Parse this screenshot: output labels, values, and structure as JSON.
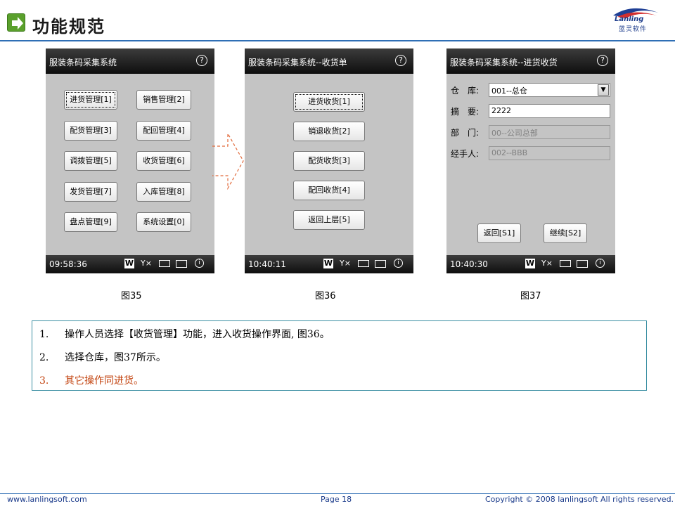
{
  "header": {
    "title": "功能规范",
    "logo_text": "Lanling",
    "logo_sub": "蓝灵软件"
  },
  "screens": [
    {
      "title": "服装条码采集系统",
      "buttons": [
        "进货管理[1]",
        "销售管理[2]",
        "配货管理[3]",
        "配回管理[4]",
        "调拨管理[5]",
        "收货管理[6]",
        "发货管理[7]",
        "入库管理[8]",
        "盘点管理[9]",
        "系统设置[0]"
      ],
      "time": "09:58:36",
      "caption": "图35"
    },
    {
      "title": "服装条码采集系统--收货单",
      "buttons": [
        "进货收货[1]",
        "销退收货[2]",
        "配货收货[3]",
        "配回收货[4]",
        "返回上层[5]"
      ],
      "time": "10:40:11",
      "caption": "图36"
    },
    {
      "title": "服装条码采集系统--进货收货",
      "fields": [
        {
          "label": "仓　库:",
          "value": "001--总仓"
        },
        {
          "label": "摘　要:",
          "value": "2222"
        },
        {
          "label": "部　门:",
          "value": "00--公司总部"
        },
        {
          "label": "经手人:",
          "value": "002--BBB"
        }
      ],
      "buttons": [
        "返回[S1]",
        "继续[S2]"
      ],
      "time": "10:40:30",
      "caption": "图37"
    }
  ],
  "status_icons": {
    "w": "W",
    "signal": "Y×",
    "battery": "",
    "keyboard": "",
    "info": "i",
    "help": "?"
  },
  "notes": [
    {
      "num": "1.",
      "text": "操作人员选择【收货管理】功能，进入收货操作界面, 图36。"
    },
    {
      "num": "2.",
      "text": "选择仓库，图37所示。"
    },
    {
      "num": "3.",
      "text": "其它操作同进货。"
    }
  ],
  "footer": {
    "website": "www.lanlingsoft.com",
    "page": "Page 18",
    "copyright": "Copyright © 2008 lanlingsoft All rights reserved."
  },
  "colors": {
    "accent_blue": "#2f6fb5",
    "note_red": "#c2410c",
    "notes_border": "#3b8fa3",
    "screen_bg": "#c4c4c4"
  }
}
